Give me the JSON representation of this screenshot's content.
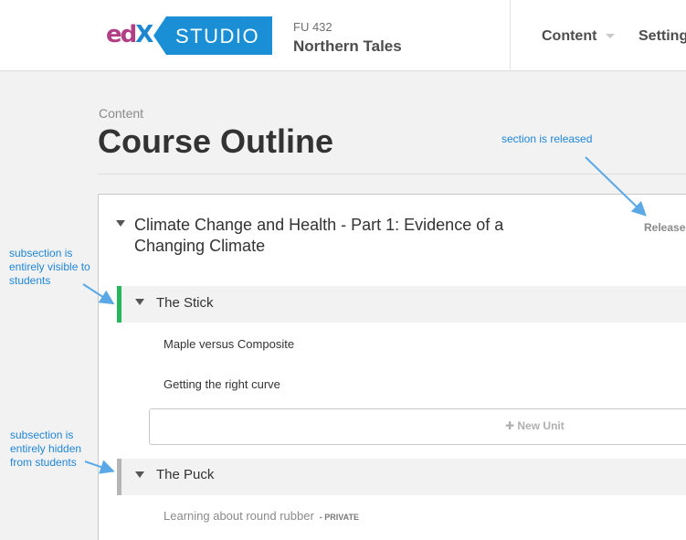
{
  "header": {
    "logo": {
      "edx_text": "edX",
      "studio_text": "STUDIO"
    },
    "course_number": "FU 432",
    "course_name": "Northern Tales",
    "nav": {
      "content_label": "Content",
      "settings_label": "Settings"
    }
  },
  "page": {
    "breadcrumb": "Content",
    "title": "Course Outline"
  },
  "outline": {
    "section": {
      "title": "Climate Change and Health - Part 1: Evidence of a Changing Climate",
      "status": "Released"
    },
    "subsections": [
      {
        "title": "The Stick",
        "visibility_color": "#25b85a",
        "units": [
          {
            "title": "Maple versus Composite"
          },
          {
            "title": "Getting the right curve"
          }
        ],
        "new_unit_label": "New Unit"
      },
      {
        "title": "The Puck",
        "visibility_color": "#b5b5b5",
        "units": [
          {
            "title": "Learning about round rubber",
            "tag": "- PRIVATE"
          }
        ]
      }
    ]
  },
  "annotations": {
    "section_released": "section is released",
    "subsection_visible": "subsection is entirely visible to students",
    "subsection_hidden": "subsection is entirely hidden from students"
  },
  "icons": [
    "caret-down-icon",
    "plus-icon",
    "arrow-annotation-icon"
  ],
  "colors": {
    "accent_blue": "#1a8fd6",
    "edx_magenta": "#b13f85",
    "visible_green": "#25b85a",
    "hidden_gray": "#b5b5b5",
    "annotation_blue": "#1f86d6"
  }
}
